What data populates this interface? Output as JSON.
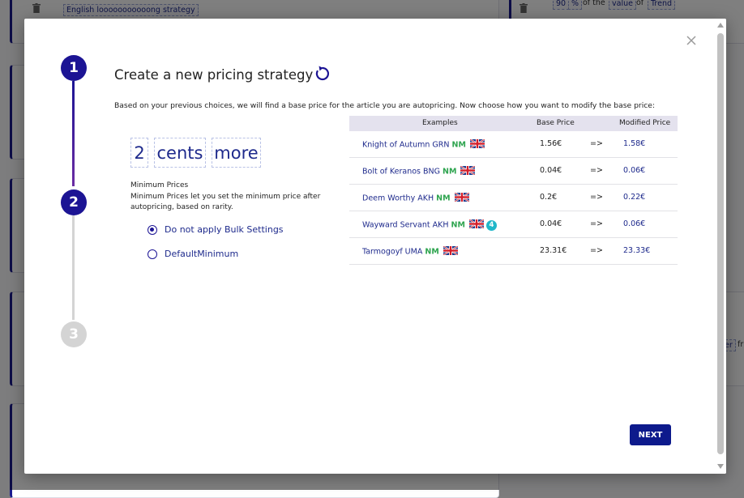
{
  "background": {
    "strategy_tag": "English looooooooooong strategy",
    "value_tokens": [
      "90",
      "%",
      "of the",
      "value",
      "of",
      "Trend"
    ],
    "right_tokens": [
      "er",
      "fr"
    ]
  },
  "modal": {
    "title": "Create a new pricing strategy",
    "subtitle": "Based on your previous choices, we will find a base price for the article you are autopricing. Now choose how you want to modify the base price:",
    "steps": [
      "1",
      "2",
      "3"
    ],
    "modifier": {
      "amount": "2",
      "unit": "cents",
      "direction": "more"
    },
    "min_prices": {
      "title": "Minimum Prices",
      "description": "Minimum Prices let you set the minimum price after autopricing, based on rarity.",
      "options": [
        {
          "label": "Do not apply Bulk Settings",
          "checked": true
        },
        {
          "label": "DefaultMinimum",
          "checked": false
        }
      ]
    },
    "table": {
      "headers": {
        "examples": "Examples",
        "base": "Base Price",
        "modified": "Modified Price"
      },
      "rows": [
        {
          "name": "Knight of Autumn GRN",
          "condition": "NM",
          "base": "1.56€",
          "arrow": "=>",
          "modified": "1.58€",
          "badge": ""
        },
        {
          "name": "Bolt of Keranos BNG",
          "condition": "NM",
          "base": "0.04€",
          "arrow": "=>",
          "modified": "0.06€",
          "badge": ""
        },
        {
          "name": "Deem Worthy AKH",
          "condition": "NM",
          "base": "0.2€",
          "arrow": "=>",
          "modified": "0.22€",
          "badge": ""
        },
        {
          "name": "Wayward Servant AKH",
          "condition": "NM",
          "base": "0.04€",
          "arrow": "=>",
          "modified": "0.06€",
          "badge": "4"
        },
        {
          "name": "Tarmogoyf UMA",
          "condition": "NM",
          "base": "23.31€",
          "arrow": "=>",
          "modified": "23.33€",
          "badge": ""
        }
      ]
    },
    "next_label": "NEXT",
    "icons": {
      "close": "close-icon",
      "reset": "reset-icon",
      "flag": "uk-flag-icon",
      "trash": "trash-icon"
    },
    "colors": {
      "primary": "#1c1494",
      "condition": "#2ea44f",
      "badge": "#20b7c9",
      "button": "#0d1a8c"
    }
  }
}
